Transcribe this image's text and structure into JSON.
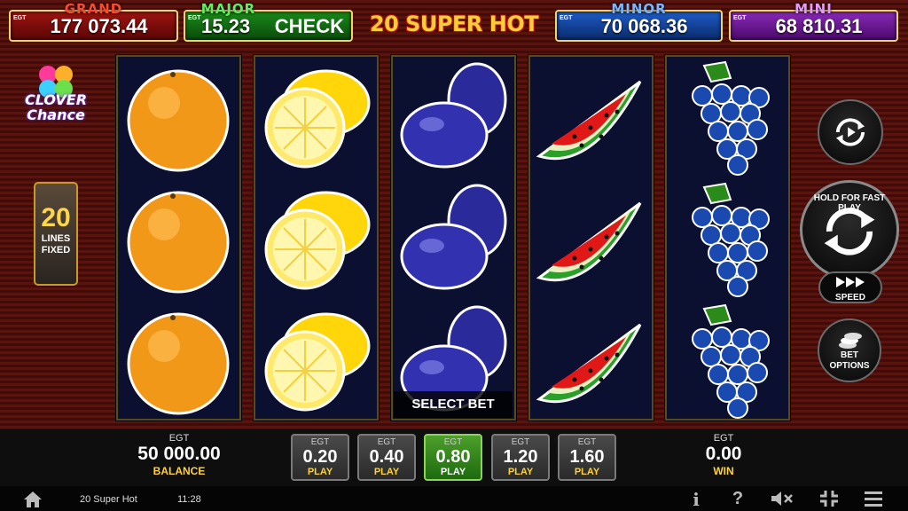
{
  "jackpots": {
    "grand": {
      "label": "GRAND",
      "value": "177 073.44",
      "egt": "EGT"
    },
    "major": {
      "label": "MAJOR",
      "value": "15.23",
      "check": "CHECK",
      "egt": "EGT"
    },
    "minor": {
      "label": "MINOR",
      "value": "70 068.36",
      "egt": "EGT"
    },
    "mini": {
      "label": "MINI",
      "value": "68 810.31",
      "egt": "EGT"
    }
  },
  "game_title": "20 SUPER HOT",
  "logo": {
    "line1": "CLOVER",
    "line2": "Chance"
  },
  "lines": {
    "count": "20",
    "label1": "LINES",
    "label2": "FIXED"
  },
  "reels": [
    [
      "orange",
      "orange",
      "orange"
    ],
    [
      "lemon",
      "lemon",
      "lemon"
    ],
    [
      "plum",
      "plum",
      "plum"
    ],
    [
      "watermelon",
      "watermelon",
      "watermelon"
    ],
    [
      "grapes",
      "grapes",
      "grapes"
    ]
  ],
  "select_bet": "SELECT BET",
  "controls": {
    "autoplay_icon": "autoplay-icon",
    "spin_hint": "HOLD FOR FAST PLAY",
    "speed": "SPEED",
    "bet_options": [
      "BET",
      "OPTIONS"
    ]
  },
  "balance": {
    "egt": "EGT",
    "value": "50 000.00",
    "label": "BALANCE"
  },
  "win": {
    "egt": "EGT",
    "value": "0.00",
    "label": "WIN"
  },
  "bets": [
    {
      "egt": "EGT",
      "value": "0.20",
      "label": "PLAY",
      "active": false
    },
    {
      "egt": "EGT",
      "value": "0.40",
      "label": "PLAY",
      "active": false
    },
    {
      "egt": "EGT",
      "value": "0.80",
      "label": "PLAY",
      "active": true
    },
    {
      "egt": "EGT",
      "value": "1.20",
      "label": "PLAY",
      "active": false
    },
    {
      "egt": "EGT",
      "value": "1.60",
      "label": "PLAY",
      "active": false
    }
  ],
  "footer": {
    "game_name": "20 Super Hot",
    "time": "11:28",
    "info": "i",
    "help": "?"
  },
  "colors": {
    "reel_bg": "#0c1030",
    "active_bet": "#4ca02a",
    "label_gold": "#ffd23a"
  }
}
